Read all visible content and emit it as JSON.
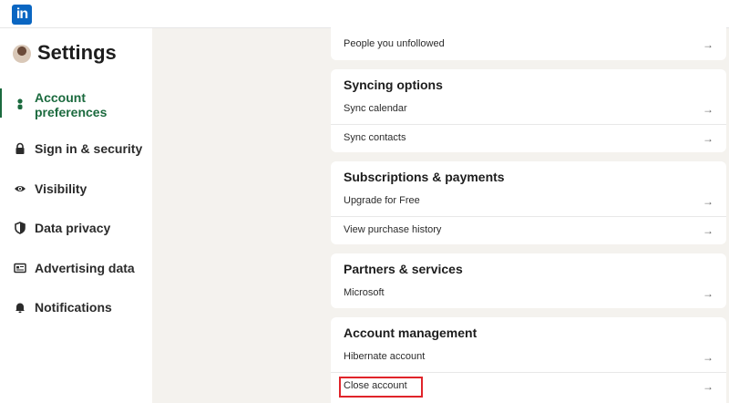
{
  "app": {
    "logo_text": "in"
  },
  "sidebar": {
    "title": "Settings",
    "items": [
      {
        "label": "Account preferences",
        "icon": "person-icon",
        "active": true
      },
      {
        "label": "Sign in & security",
        "icon": "lock-icon",
        "active": false
      },
      {
        "label": "Visibility",
        "icon": "eye-icon",
        "active": false
      },
      {
        "label": "Data privacy",
        "icon": "shield-icon",
        "active": false
      },
      {
        "label": "Advertising data",
        "icon": "newspaper-icon",
        "active": false
      },
      {
        "label": "Notifications",
        "icon": "bell-icon",
        "active": false
      }
    ]
  },
  "main": {
    "top_card": {
      "rows": [
        {
          "label": "People you unfollowed"
        }
      ]
    },
    "syncing": {
      "title": "Syncing options",
      "rows": [
        {
          "label": "Sync calendar"
        },
        {
          "label": "Sync contacts"
        }
      ]
    },
    "subscriptions": {
      "title": "Subscriptions & payments",
      "rows": [
        {
          "label": "Upgrade for Free"
        },
        {
          "label": "View purchase history"
        }
      ]
    },
    "partners": {
      "title": "Partners & services",
      "rows": [
        {
          "label": "Microsoft"
        }
      ]
    },
    "account_management": {
      "title": "Account management",
      "rows": [
        {
          "label": "Hibernate account"
        },
        {
          "label": "Close account",
          "highlighted": true
        }
      ]
    },
    "arrow_glyph": "→"
  },
  "colors": {
    "accent": "#1b6a3e",
    "brand": "#0a66c2",
    "highlight": "#e0242a",
    "background": "#f4f2ee"
  }
}
